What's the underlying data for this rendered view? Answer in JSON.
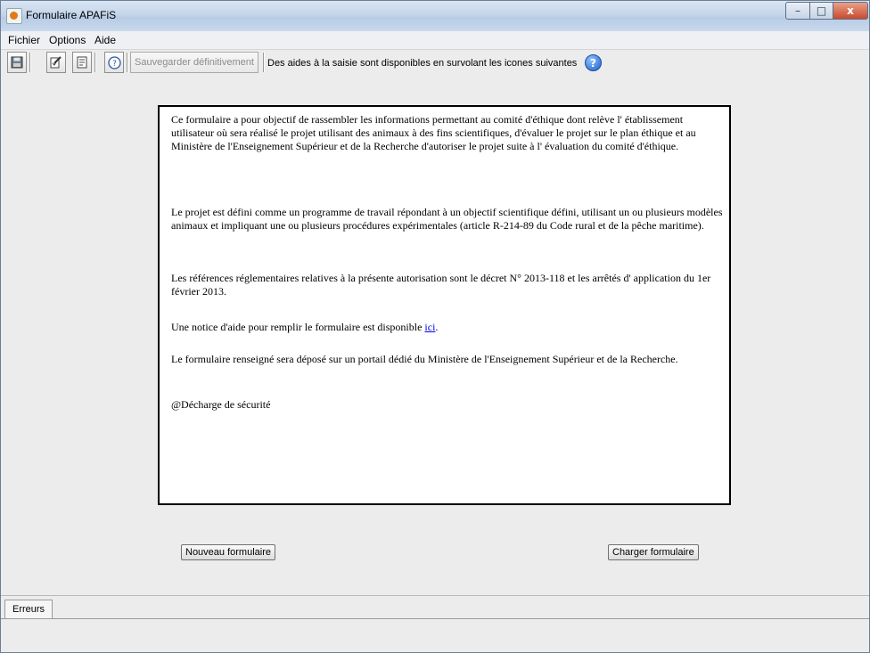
{
  "window": {
    "title": "Formulaire APAFiS",
    "controls": {
      "minimize": "–",
      "maximize": "□",
      "close": "x"
    }
  },
  "menu": {
    "items": [
      "Fichier",
      "Options",
      "Aide"
    ]
  },
  "toolbar": {
    "icons": [
      "save-icon",
      "edit-check-icon",
      "document-icon",
      "help-circle-icon"
    ],
    "save_final_label": "Sauvegarder définitivement",
    "help_text": "Des aides à la saisie sont disponibles en survolant les icones suivantes",
    "help_icon_glyph": "?"
  },
  "info": {
    "p1": "Ce formulaire a pour objectif de rassembler les informations permettant au comité d'éthique dont relève l' établissement utilisateur où sera réalisé le projet utilisant des animaux à des fins scientifiques, d'évaluer le projet sur le plan éthique et au Ministère de l'Enseignement Supérieur et de la Recherche d'autoriser le projet suite à l' évaluation du comité d'éthique.",
    "p2": "Le projet est défini comme un programme de travail répondant à un objectif scientifique défini, utilisant un ou plusieurs modèles animaux et impliquant une ou plusieurs procédures expérimentales (article R-214-89 du Code rural et de la pêche maritime).",
    "p3": "Les références réglementaires relatives à la présente autorisation sont le décret N° 2013-118 et les arrêtés d' application du 1er février 2013.",
    "p4_prefix": "Une notice d'aide pour remplir le formulaire est disponible ",
    "p4_link": "ici",
    "p4_suffix": ".",
    "p5": "Le formulaire renseigné sera déposé sur un portail dédié du Ministère de l'Enseignement Supérieur et de la Recherche.",
    "p6": "@Décharge de sécurité"
  },
  "buttons": {
    "new_form": "Nouveau formulaire",
    "load_form": "Charger formulaire"
  },
  "bottom": {
    "tab_errors": "Erreurs"
  }
}
